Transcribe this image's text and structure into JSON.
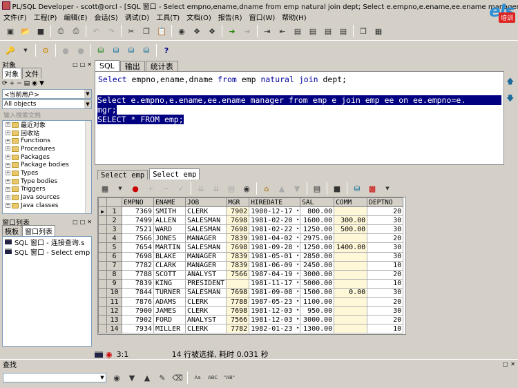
{
  "window": {
    "title": "PL/SQL Developer - scott@orcl - [SQL 窗口 - Select empno,ename,dname from emp natural join dept; Select e.empno,e.ename,ee.ename manager fro ...]",
    "logo": "els",
    "logo_badge": "培训"
  },
  "menu": [
    "文件(F)",
    "工程(P)",
    "编辑(E)",
    "会话(S)",
    "调试(D)",
    "工具(T)",
    "文档(O)",
    "报告(R)",
    "窗口(W)",
    "帮助(H)"
  ],
  "left_panel": {
    "header": "对象",
    "tabs": [
      "对象",
      "文件"
    ],
    "user_combo": "<当前用户>",
    "filter_combo": "All objects",
    "search_placeholder": "输入搜索文档",
    "tree_items": [
      "最近对象",
      "回收站",
      "Functions",
      "Procedures",
      "Packages",
      "Package bodies",
      "Types",
      "Type bodies",
      "Triggers",
      "Java sources",
      "Java classes"
    ],
    "window_list_header": "窗口列表",
    "window_list_tabs": [
      "模板",
      "窗口列表"
    ],
    "window_list_items": [
      "SQL 窗口 - 连接查询.s",
      "SQL 窗口 - Select emp"
    ]
  },
  "editor": {
    "tabs": [
      "SQL",
      "输出",
      "统计表"
    ],
    "line1": "Select empno,ename,dname from emp natural join dept;",
    "line2": "Select e.empno,e.ename,ee.ename manager from emp e join emp ee on ee.empno=e.",
    "line3": "mgr;",
    "line4": "SELECT * FROM emp;"
  },
  "results": {
    "tabs": [
      "Select emp",
      "Select emp"
    ],
    "columns": [
      "EMPNO",
      "ENAME",
      "JOB",
      "MGR",
      "HIREDATE",
      "SAL",
      "COMM",
      "DEPTNO"
    ],
    "rows": [
      [
        "1",
        "7369",
        "SMITH",
        "CLERK",
        "7902",
        "1980-12-17",
        "800.00",
        "",
        "20"
      ],
      [
        "2",
        "7499",
        "ALLEN",
        "SALESMAN",
        "7698",
        "1981-02-20",
        "1600.00",
        "300.00",
        "30"
      ],
      [
        "3",
        "7521",
        "WARD",
        "SALESMAN",
        "7698",
        "1981-02-22",
        "1250.00",
        "500.00",
        "30"
      ],
      [
        "4",
        "7566",
        "JONES",
        "MANAGER",
        "7839",
        "1981-04-02",
        "2975.00",
        "",
        "20"
      ],
      [
        "5",
        "7654",
        "MARTIN",
        "SALESMAN",
        "7698",
        "1981-09-28",
        "1250.00",
        "1400.00",
        "30"
      ],
      [
        "6",
        "7698",
        "BLAKE",
        "MANAGER",
        "7839",
        "1981-05-01",
        "2850.00",
        "",
        "30"
      ],
      [
        "7",
        "7782",
        "CLARK",
        "MANAGER",
        "7839",
        "1981-06-09",
        "2450.00",
        "",
        "10"
      ],
      [
        "8",
        "7788",
        "SCOTT",
        "ANALYST",
        "7566",
        "1987-04-19",
        "3000.00",
        "",
        "20"
      ],
      [
        "9",
        "7839",
        "KING",
        "PRESIDENT",
        "",
        "1981-11-17",
        "5000.00",
        "",
        "10"
      ],
      [
        "10",
        "7844",
        "TURNER",
        "SALESMAN",
        "7698",
        "1981-09-08",
        "1500.00",
        "0.00",
        "30"
      ],
      [
        "11",
        "7876",
        "ADAMS",
        "CLERK",
        "7788",
        "1987-05-23",
        "1100.00",
        "",
        "20"
      ],
      [
        "12",
        "7900",
        "JAMES",
        "CLERK",
        "7698",
        "1981-12-03",
        "950.00",
        "",
        "30"
      ],
      [
        "13",
        "7902",
        "FORD",
        "ANALYST",
        "7566",
        "1981-12-03",
        "3000.00",
        "",
        "20"
      ],
      [
        "14",
        "7934",
        "MILLER",
        "CLERK",
        "7782",
        "1982-01-23",
        "1300.00",
        "",
        "10"
      ]
    ]
  },
  "status": {
    "position": "3:1",
    "message": "14 行被选择, 耗时 0.031 秒"
  },
  "find": {
    "header": "查找",
    "icons": [
      "binoculars-icon",
      "find-next-icon",
      "find-prev-icon",
      "highlight-icon",
      "clear-icon"
    ],
    "options": [
      "ABC",
      "\"AB\""
    ]
  }
}
